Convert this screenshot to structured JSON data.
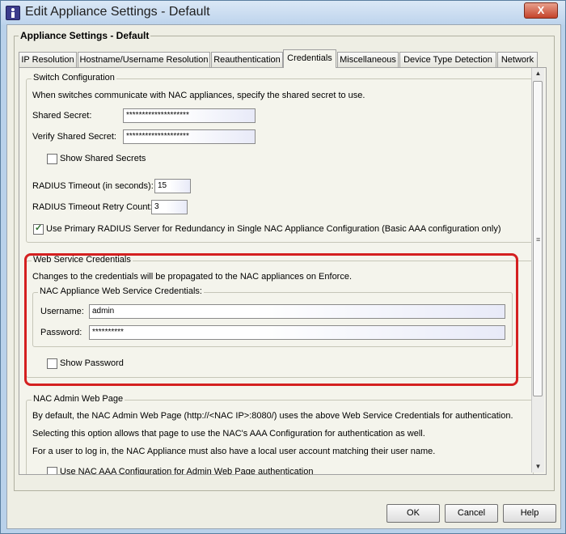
{
  "window": {
    "title": "Edit Appliance Settings - Default",
    "close_label": "X"
  },
  "settings": {
    "legend": "Appliance Settings - Default"
  },
  "tabs": [
    {
      "label": "IP Resolution"
    },
    {
      "label": "Hostname/Username Resolution"
    },
    {
      "label": "Reauthentication"
    },
    {
      "label": "Credentials"
    },
    {
      "label": "Miscellaneous"
    },
    {
      "label": "Device Type Detection"
    },
    {
      "label": "Network"
    }
  ],
  "active_tab": "Credentials",
  "switch_config": {
    "legend": "Switch Configuration",
    "description": "When switches communicate with NAC appliances, specify the shared secret to use.",
    "shared_secret_label": "Shared Secret:",
    "shared_secret_value": "********************",
    "verify_secret_label": "Verify Shared Secret:",
    "verify_secret_value": "********************",
    "show_secrets_label": "Show Shared Secrets",
    "radius_timeout_label": "RADIUS Timeout (in seconds):",
    "radius_timeout_value": "15",
    "radius_retry_label": "RADIUS Timeout Retry Count:",
    "radius_retry_value": "3",
    "use_primary_label": "Use Primary RADIUS Server for Redundancy in Single NAC Appliance Configuration (Basic AAA configuration only)"
  },
  "web_service": {
    "legend": "Web Service Credentials",
    "description": "Changes to the credentials will be propagated to the NAC appliances on Enforce.",
    "sub_legend": "NAC Appliance Web Service Credentials:",
    "username_label": "Username:",
    "username_value": "admin",
    "password_label": "Password:",
    "password_value": "**********",
    "show_password_label": "Show Password"
  },
  "nac_admin": {
    "legend": "NAC Admin Web Page",
    "line1": "By default, the NAC Admin Web Page (http://<NAC IP>:8080/) uses the above Web Service Credentials for authentication.",
    "line2": "Selecting this option allows that page to use the NAC's AAA Configuration for authentication as well.",
    "line3": "For a user to log in, the NAC Appliance must also have a local user account matching their user name.",
    "use_aaa_label": "Use NAC AAA Configuration for Admin Web Page authentication"
  },
  "buttons": {
    "ok": "OK",
    "cancel": "Cancel",
    "help": "Help"
  },
  "colors": {
    "highlight": "#d42020",
    "titlebar": "#bcd3ec",
    "panel": "#f4f4ec"
  }
}
